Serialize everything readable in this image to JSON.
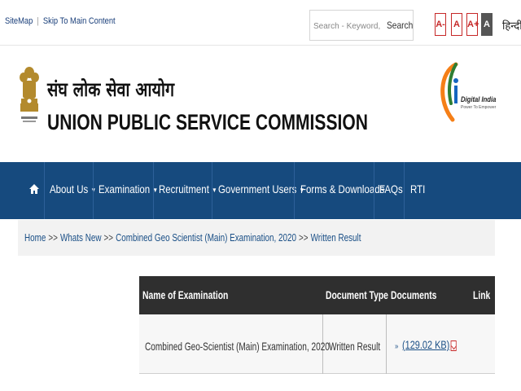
{
  "top": {
    "sitemap": "SiteMap",
    "skip": "Skip To Main Content",
    "search_placeholder": "Search - Keyword, Phrase",
    "search_button": "Search",
    "font_sizes": [
      "A-",
      "A",
      "A+",
      "A"
    ],
    "language": "हिन्दी"
  },
  "header": {
    "hindi_title": "संघ लोक सेवा आयोग",
    "english_title": "UNION PUBLIC SERVICE COMMISSION",
    "digital_india": "Digital India",
    "digital_india_sub": "Power To Empower"
  },
  "nav": {
    "items": [
      {
        "label": "About Us",
        "dropdown": true
      },
      {
        "label": "Examination",
        "dropdown": true
      },
      {
        "label": "Recruitment",
        "dropdown": true
      },
      {
        "label": "Government Users",
        "dropdown": true
      },
      {
        "label": "Forms & Downloads",
        "dropdown": false
      },
      {
        "label": "FAQs",
        "dropdown": false
      },
      {
        "label": "RTI",
        "dropdown": false
      }
    ],
    "caret": "▼"
  },
  "breadcrumb": {
    "items": [
      "Home",
      "Whats New",
      "Combined Geo Scientist (Main) Examination, 2020",
      "Written Result"
    ],
    "separator": ">>"
  },
  "table": {
    "headers": [
      "Name of Examination",
      "Document Type",
      "Documents",
      "Link"
    ],
    "rows": [
      {
        "exam": "Combined Geo-Scientist (Main) Examination, 2020",
        "doc_type": "Written Result",
        "document": "(129.02 KB)",
        "bullet": "»"
      }
    ]
  },
  "colors": {
    "nav_bg": "#164a7e",
    "table_header_bg": "#2f2f2f",
    "link": "#1a4f86",
    "accent_red": "#c62828"
  }
}
